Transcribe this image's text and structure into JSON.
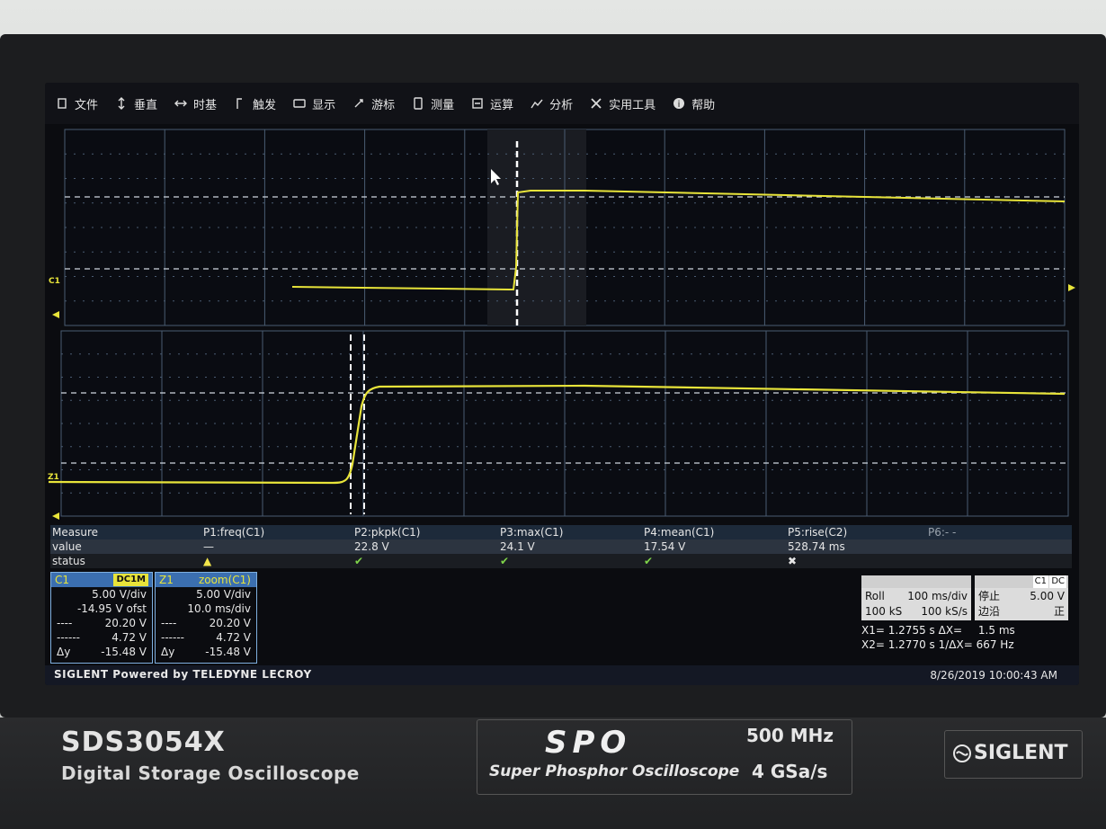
{
  "menu": [
    {
      "label": "文件",
      "icon": "file-icon"
    },
    {
      "label": "垂直",
      "icon": "vertical-arrows-icon"
    },
    {
      "label": "时基",
      "icon": "horizontal-arrows-icon"
    },
    {
      "label": "触发",
      "icon": "trigger-icon"
    },
    {
      "label": "显示",
      "icon": "display-icon"
    },
    {
      "label": "游标",
      "icon": "cursor-icon"
    },
    {
      "label": "测量",
      "icon": "measure-icon"
    },
    {
      "label": "运算",
      "icon": "math-icon"
    },
    {
      "label": "分析",
      "icon": "analysis-icon"
    },
    {
      "label": "实用工具",
      "icon": "tools-icon"
    },
    {
      "label": "帮助",
      "icon": "help-icon"
    }
  ],
  "markers": {
    "top_channel": "C1",
    "bottom_channel": "Z1"
  },
  "measure": {
    "label": "Measure",
    "value_label": "value",
    "status_label": "status",
    "p6": "P6:- -",
    "params": [
      {
        "name": "P1:freq(C1)",
        "value": "—",
        "status": "warning"
      },
      {
        "name": "P2:pkpk(C1)",
        "value": "22.8 V",
        "status": "ok"
      },
      {
        "name": "P3:max(C1)",
        "value": "24.1 V",
        "status": "ok"
      },
      {
        "name": "P4:mean(C1)",
        "value": "17.54 V",
        "status": "ok"
      },
      {
        "name": "P5:rise(C2)",
        "value": "528.74 ms",
        "status": "fail"
      }
    ]
  },
  "channel1": {
    "name": "C1",
    "coupling": "DC1M",
    "vdiv": "5.00 V/div",
    "offset": "-14.95 V ofst",
    "y1_label": "----",
    "y1": "20.20 V",
    "y2_label": "------",
    "y2": "4.72 V",
    "dy_label": "Δy",
    "dy": "-15.48 V"
  },
  "zoom": {
    "name": "Z1",
    "title": "zoom(C1)",
    "vdiv": "5.00 V/div",
    "hdiv": "10.0 ms/div",
    "y1_label": "----",
    "y1": "20.20 V",
    "y2_label": "------",
    "y2": "4.72 V",
    "dy_label": "Δy",
    "dy": "-15.48 V"
  },
  "timebase": {
    "mode": "Roll",
    "tdiv": "100 ms/div",
    "mem": "100 kS",
    "rate": "100 kS/s"
  },
  "trigger": {
    "channel": "C1",
    "coupling": "DC",
    "state": "停止",
    "level": "5.00 V",
    "slope": "边沿",
    "polarity": "正"
  },
  "cursors": {
    "x1": "X1= 1.2755 s",
    "dx_label": "ΔX=",
    "dx": "1.5 ms",
    "x2": "X2= 1.2770 s",
    "inv_dx": "1/ΔX= 667 Hz"
  },
  "footer": {
    "brand": "SIGLENT Powered by TELEDYNE LECROY",
    "datetime": "8/26/2019 10:00:43 AM"
  },
  "instrument": {
    "model": "SDS3054X",
    "model_desc": "Digital Storage Oscilloscope",
    "spo": "SPO",
    "spo_desc": "Super Phosphor Oscilloscope",
    "bandwidth": "500 MHz",
    "sample_rate": "4 GSa/s",
    "logo": "SIGLENT"
  },
  "colors": {
    "trace": "#e8e43a",
    "grid": "#4a5c72",
    "accent": "#3b6fb0"
  }
}
